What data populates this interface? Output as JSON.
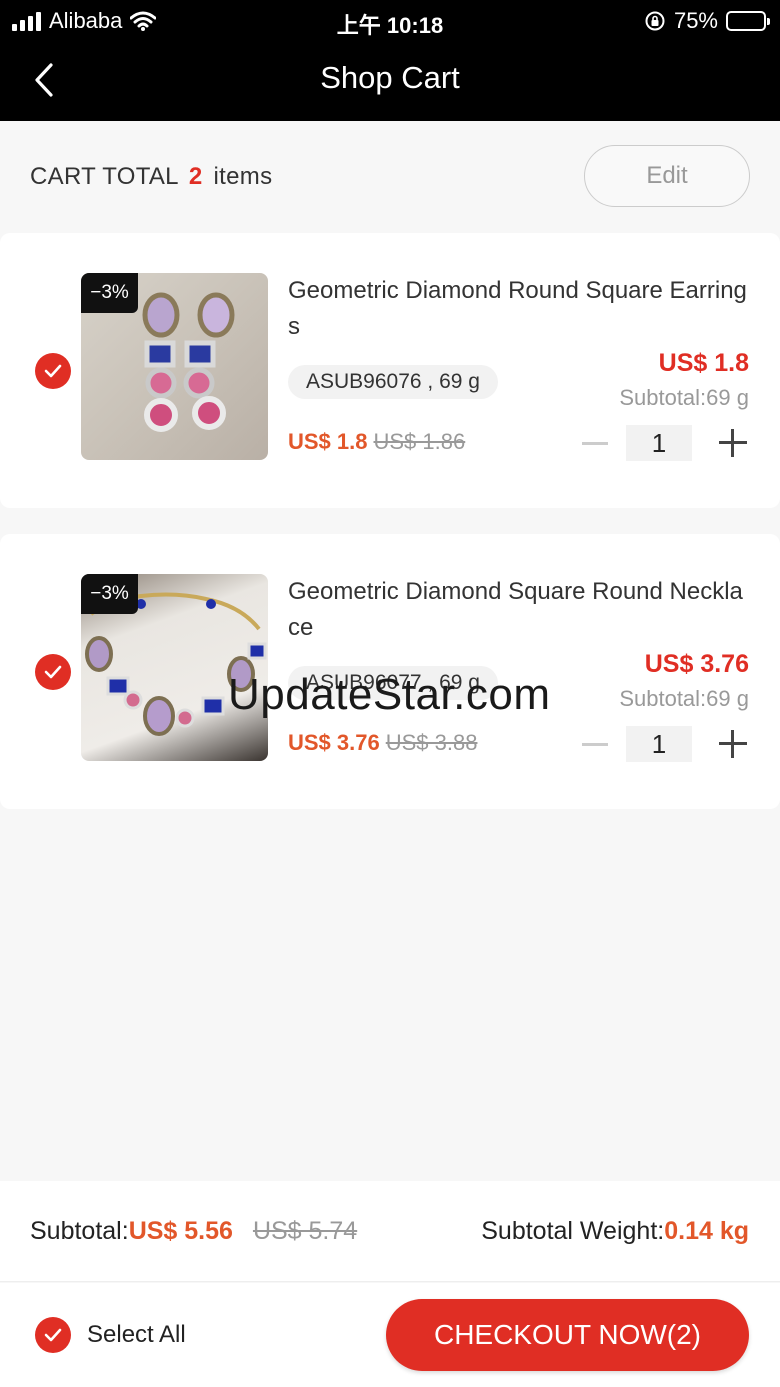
{
  "status_bar": {
    "carrier": "Alibaba",
    "time": "上午 10:18",
    "battery": "75%",
    "battery_level": 0.75
  },
  "navbar": {
    "title": "Shop Cart",
    "back_icon": "chevron-left-icon"
  },
  "cart_header": {
    "label": "CART TOTAL",
    "count": "2",
    "items_word": "items",
    "edit_label": "Edit"
  },
  "items": [
    {
      "badge": "−3%",
      "title": "Geometric Diamond Round Square Earrings",
      "variant": "ASUB96076 , 69 g",
      "price": "US$ 1.8",
      "subtotal": "Subtotal:69 g",
      "price_now": "US$ 1.8",
      "price_old": "US$ 1.86",
      "quantity": "1",
      "checked": true
    },
    {
      "badge": "−3%",
      "title": "Geometric Diamond Square Round Necklace",
      "variant": "ASUB96077 , 69 g",
      "price": "US$ 3.76",
      "subtotal": "Subtotal:69 g",
      "price_now": "US$ 3.76",
      "price_old": "US$ 3.88",
      "quantity": "1",
      "checked": true
    }
  ],
  "watermark": "UpdateStar.com",
  "summary": {
    "subtotal_label": "Subtotal:",
    "subtotal_now": "US$ 5.56",
    "subtotal_old": "US$ 5.74",
    "weight_label": "Subtotal Weight:",
    "weight_value": "0.14 kg"
  },
  "footer": {
    "select_all_label": "Select All",
    "checkout_label": "CHECKOUT NOW(2)"
  },
  "colors": {
    "accent": "#e02e24",
    "price_orange": "#e2572a",
    "header_bg": "#000000"
  }
}
